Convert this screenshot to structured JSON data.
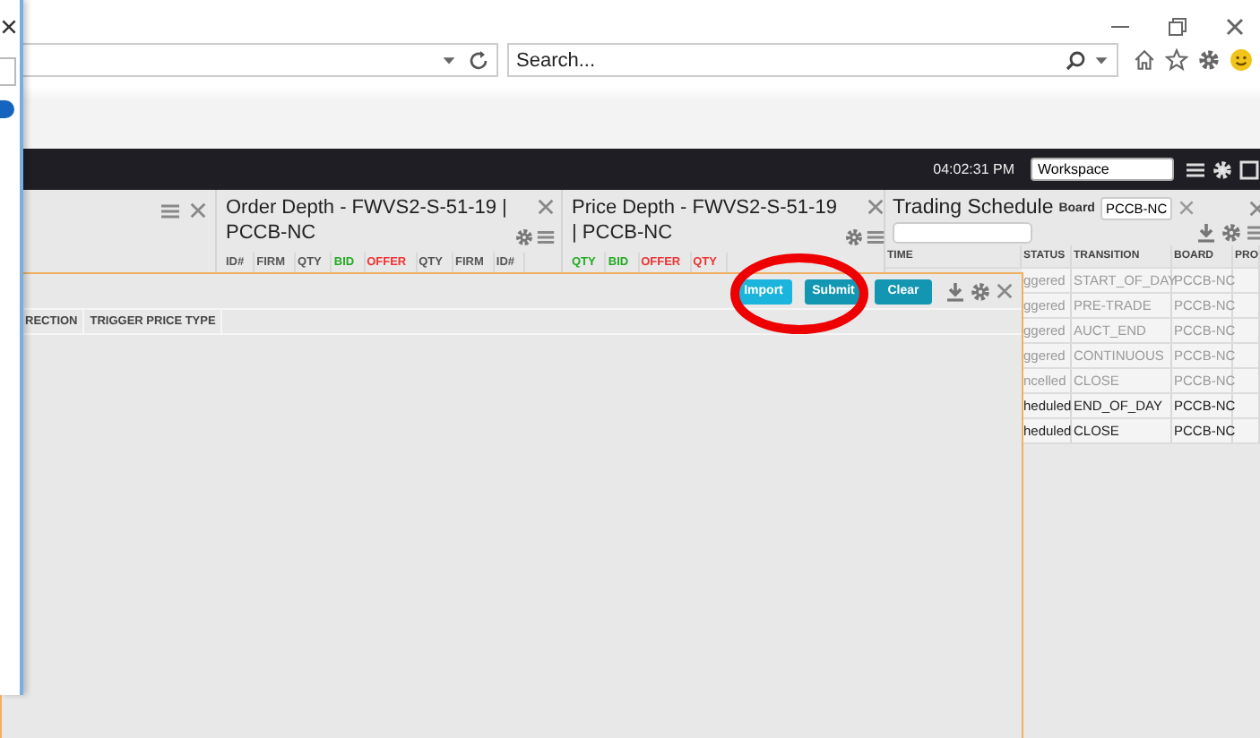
{
  "browser": {
    "search": {
      "placeholder": "Search..."
    }
  },
  "app_bar": {
    "time": "04:02:31 PM",
    "workspace": {
      "value": "Workspace"
    }
  },
  "order_depth": {
    "title": "Order Depth - FWVS2-S-51-19 | PCCB-NC",
    "columns": [
      {
        "label": "ID#",
        "color": "#555555"
      },
      {
        "label": "FIRM",
        "color": "#555555"
      },
      {
        "label": "QTY",
        "color": "#555555"
      },
      {
        "label": "BID",
        "color": "#22aa22"
      },
      {
        "label": "OFFER",
        "color": "#ee3333"
      },
      {
        "label": "QTY",
        "color": "#555555"
      },
      {
        "label": "FIRM",
        "color": "#555555"
      },
      {
        "label": "ID#",
        "color": "#555555"
      }
    ]
  },
  "price_depth": {
    "title": "Price Depth - FWVS2-S-51-19 | PCCB-NC",
    "columns": [
      {
        "label": "QTY",
        "color": "#22aa22"
      },
      {
        "label": "BID",
        "color": "#22aa22"
      },
      {
        "label": "OFFER",
        "color": "#ee3333"
      },
      {
        "label": "QTY",
        "color": "#ee3333"
      }
    ]
  },
  "trading_schedule": {
    "title": "Trading Schedule",
    "board_label": "Board",
    "board": {
      "value": "PCCB-NC"
    },
    "columns": [
      "TIME",
      "STATUS",
      "TRANSITION",
      "BOARD",
      "PRO"
    ],
    "rows": [
      {
        "status": "ggered",
        "transition": "START_OF_DAY",
        "board": "PCCB-NC",
        "disabled": true
      },
      {
        "status": "ggered",
        "transition": "PRE-TRADE",
        "board": "PCCB-NC",
        "disabled": true
      },
      {
        "status": "ggered",
        "transition": "AUCT_END",
        "board": "PCCB-NC",
        "disabled": true
      },
      {
        "status": "ggered",
        "transition": "CONTINUOUS",
        "board": "PCCB-NC",
        "disabled": true
      },
      {
        "status": "ncelled",
        "transition": "CLOSE",
        "board": "PCCB-NC",
        "disabled": true
      },
      {
        "status": "heduled",
        "transition": "END_OF_DAY",
        "board": "PCCB-NC",
        "disabled": false
      },
      {
        "status": "heduled",
        "transition": "CLOSE",
        "board": "PCCB-NC",
        "disabled": false
      }
    ]
  },
  "order_entry": {
    "buttons": [
      {
        "label": "Import",
        "color": "#1ab4dc"
      },
      {
        "label": "Submit",
        "color": "#1396b2"
      },
      {
        "label": "Clear",
        "color": "#1396b2"
      }
    ],
    "columns": [
      "RECTION",
      "TRIGGER PRICE TYPE"
    ]
  }
}
